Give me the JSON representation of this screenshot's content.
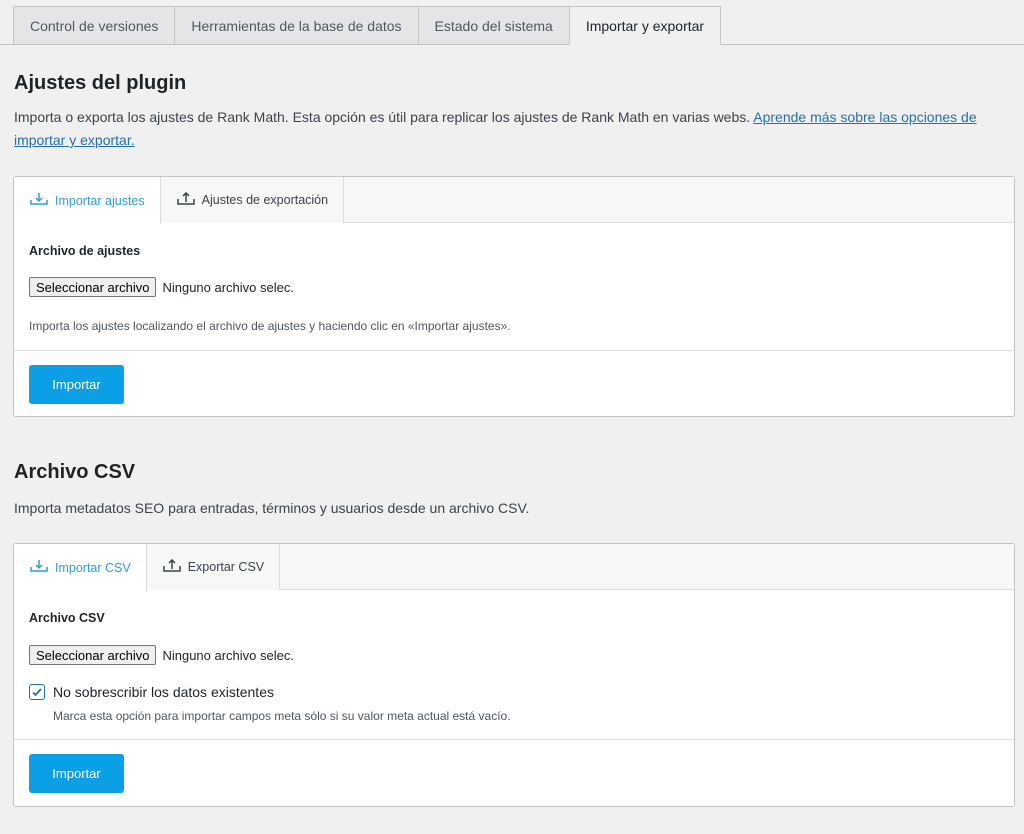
{
  "top_tabs": [
    {
      "label": "Control de versiones"
    },
    {
      "label": "Herramientas de la base de datos"
    },
    {
      "label": "Estado del sistema"
    },
    {
      "label": "Importar y exportar"
    }
  ],
  "plugin_section": {
    "title": "Ajustes del plugin",
    "desc_text": "Importa o exporta los ajustes de Rank Math. Esta opción es útil para replicar los ajustes de Rank Math en varias webs. ",
    "desc_link": "Aprende más sobre las opciones de importar y exportar.",
    "tabs": [
      {
        "label": "Importar ajustes",
        "icon": "import-icon"
      },
      {
        "label": "Ajustes de exportación",
        "icon": "export-icon"
      }
    ],
    "field_label": "Archivo de ajustes",
    "file_button": "Seleccionar archivo",
    "file_status": "Ninguno archivo selec.",
    "help": "Importa los ajustes localizando el archivo de ajustes y haciendo clic en «Importar ajustes».",
    "submit": "Importar"
  },
  "csv_section": {
    "title": "Archivo CSV",
    "desc_text": "Importa metadatos SEO para entradas, términos y usuarios desde un archivo CSV.",
    "tabs": [
      {
        "label": "Importar CSV",
        "icon": "import-icon"
      },
      {
        "label": "Exportar CSV",
        "icon": "export-icon"
      }
    ],
    "field_label": "Archivo CSV",
    "file_button": "Seleccionar archivo",
    "file_status": "Ninguno archivo selec.",
    "checkbox_label": "No sobrescribir los datos existentes",
    "checkbox_help": "Marca esta opción para importar campos meta sólo si su valor meta actual está vacío.",
    "submit": "Importar"
  },
  "colors": {
    "accent": "#0ba0e6",
    "link": "#2271b1",
    "active_tab_text": "#2c9fd8"
  }
}
